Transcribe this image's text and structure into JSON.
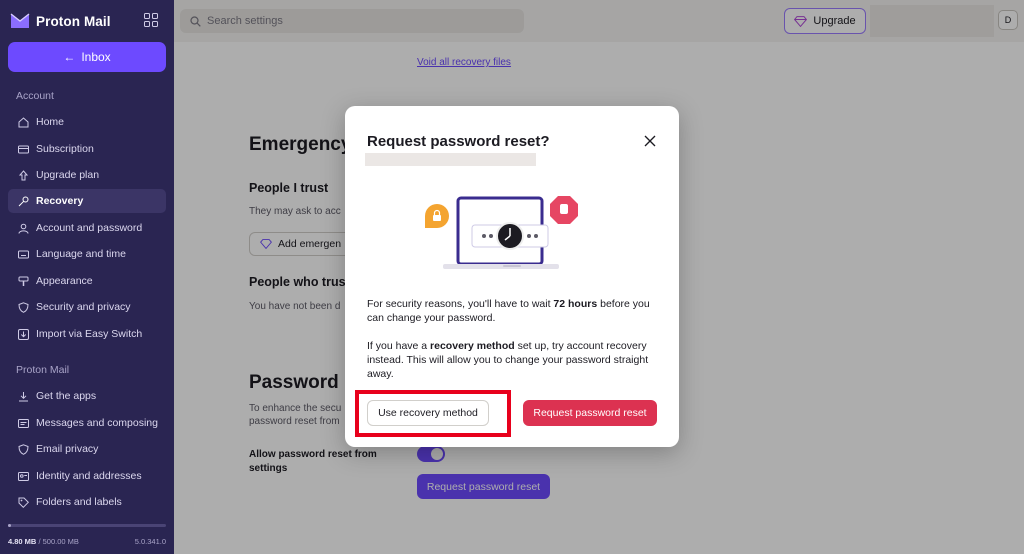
{
  "app": {
    "name": "Proton Mail"
  },
  "sidebar": {
    "inbox_label": "Inbox",
    "sections": [
      {
        "title": "Account",
        "items": [
          {
            "label": "Home",
            "icon": "home-icon"
          },
          {
            "label": "Subscription",
            "icon": "card-icon"
          },
          {
            "label": "Upgrade plan",
            "icon": "upgrade-icon"
          },
          {
            "label": "Recovery",
            "icon": "key-icon",
            "active": true
          },
          {
            "label": "Account and password",
            "icon": "user-icon"
          },
          {
            "label": "Language and time",
            "icon": "keyboard-icon"
          },
          {
            "label": "Appearance",
            "icon": "paint-icon"
          },
          {
            "label": "Security and privacy",
            "icon": "shield-icon"
          },
          {
            "label": "Import via Easy Switch",
            "icon": "import-icon"
          }
        ]
      },
      {
        "title": "Proton Mail",
        "items": [
          {
            "label": "Get the apps",
            "icon": "download-icon"
          },
          {
            "label": "Messages and composing",
            "icon": "messages-icon"
          },
          {
            "label": "Email privacy",
            "icon": "shield-icon"
          },
          {
            "label": "Identity and addresses",
            "icon": "id-icon"
          },
          {
            "label": "Folders and labels",
            "icon": "tag-icon"
          }
        ]
      }
    ],
    "storage": {
      "used": "4.80 MB",
      "separator": " / ",
      "total": "500.00 MB",
      "fraction": 0.01,
      "version": "5.0.341.0"
    }
  },
  "topbar": {
    "search_placeholder": "Search settings",
    "upgrade_label": "Upgrade",
    "avatar_initial": "D"
  },
  "main": {
    "void_link": "Void all recovery files",
    "emergency_heading": "Emergency",
    "people_trust_heading": "People I trust",
    "people_trust_desc": "They may ask to acc",
    "add_emergency_label": "Add emergen",
    "people_who_trust_heading": "People who trus",
    "people_who_trust_desc": "You have not been d",
    "password_heading": "Password",
    "password_desc_1": "To enhance the secu",
    "password_desc_2": "password reset from",
    "allow_label": "Allow password reset from settings",
    "request_reset_label": "Request password reset"
  },
  "modal": {
    "title": "Request password reset?",
    "p1_before": "For security reasons, you'll have to wait ",
    "p1_bold": "72 hours",
    "p1_after": " before you can change your password.",
    "p2_before": "If you have a ",
    "p2_bold": "recovery method",
    "p2_after": " set up, try account recovery instead. This will allow you to change your password straight away.",
    "use_recovery_label": "Use recovery method",
    "request_reset_label": "Request password reset"
  },
  "colors": {
    "accent": "#6d4aff",
    "danger": "#dc3251",
    "sidebar": "#2a2552",
    "highlight": "#e8001c"
  }
}
